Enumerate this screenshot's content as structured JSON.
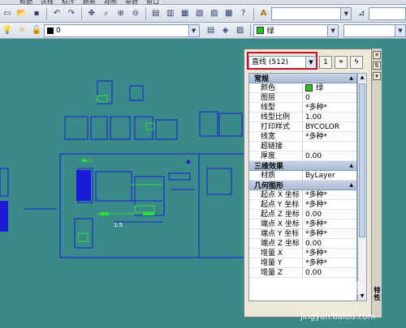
{
  "menu": [
    "帮助",
    "选择",
    "标注",
    "刷新",
    "视图",
    "参数",
    "窗口"
  ],
  "toolbar1": {
    "style_combo": "",
    "dim_combo": ""
  },
  "toolbar2": {
    "layer_value": "0",
    "color_value": "绿"
  },
  "palette": {
    "object_selector": "直线 (512)",
    "quick_select_label": "1",
    "side_title": "特性",
    "categories": [
      {
        "name": "常规",
        "rows": [
          {
            "name": "颜色",
            "value": "绿",
            "swatch": true
          },
          {
            "name": "图层",
            "value": "0"
          },
          {
            "name": "线型",
            "value": "*多种*"
          },
          {
            "name": "线型比例",
            "value": "1.00"
          },
          {
            "name": "打印样式",
            "value": "BYCOLOR"
          },
          {
            "name": "线宽",
            "value": "*多种*"
          },
          {
            "name": "超链接",
            "value": ""
          },
          {
            "name": "厚度",
            "value": "0.00"
          }
        ]
      },
      {
        "name": "三维效果",
        "rows": [
          {
            "name": "材质",
            "value": "ByLayer"
          }
        ]
      },
      {
        "name": "几何图形",
        "rows": [
          {
            "name": "起点 X 坐标",
            "value": "*多种*"
          },
          {
            "name": "起点 Y 坐标",
            "value": "*多种*"
          },
          {
            "name": "起点 Z 坐标",
            "value": "0.00"
          },
          {
            "name": "端点 X 坐标",
            "value": "*多种*"
          },
          {
            "name": "端点 Y 坐标",
            "value": "*多种*"
          },
          {
            "name": "端点 Z 坐标",
            "value": "0.00"
          },
          {
            "name": "增量 X",
            "value": "*多种*"
          },
          {
            "name": "增量 Y",
            "value": "*多种*"
          },
          {
            "name": "增量 Z",
            "value": "0.00"
          }
        ]
      }
    ]
  },
  "drawing": {
    "label_scale": "1:5"
  },
  "watermark": {
    "text": "Baidu经验",
    "url": "jingyan.baidu.com"
  },
  "colors": {
    "canvas": "#3a8a8a",
    "line_blue": "#1b1bd8",
    "line_green": "#2ee02e",
    "highlight": "#c8102e"
  }
}
